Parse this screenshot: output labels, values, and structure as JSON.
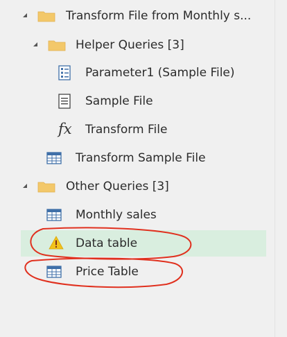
{
  "tree": {
    "groups": [
      {
        "label": "Transform File from Monthly s...",
        "icon": "folder-icon"
      },
      {
        "label": "Helper Queries [3]",
        "icon": "folder-icon"
      },
      {
        "label": "Other Queries [3]",
        "icon": "folder-icon"
      }
    ],
    "helper_items": [
      {
        "label": "Parameter1 (Sample File)",
        "icon": "parameter-icon"
      },
      {
        "label": "Sample File",
        "icon": "document-icon"
      },
      {
        "label": "Transform File",
        "icon": "function-icon"
      }
    ],
    "transform_sample": {
      "label": "Transform Sample File",
      "icon": "table-icon"
    },
    "other_items": [
      {
        "label": "Monthly sales",
        "icon": "table-icon"
      },
      {
        "label": "Data table",
        "icon": "warning-icon",
        "selected": true
      },
      {
        "label": "Price Table",
        "icon": "table-icon"
      }
    ]
  },
  "colors": {
    "selected_row": "#d9eedf",
    "folder": "#f3c86a",
    "table_icon": "#3f6fa8",
    "warning": "#f2c21b",
    "annotation": "#e0301e"
  }
}
